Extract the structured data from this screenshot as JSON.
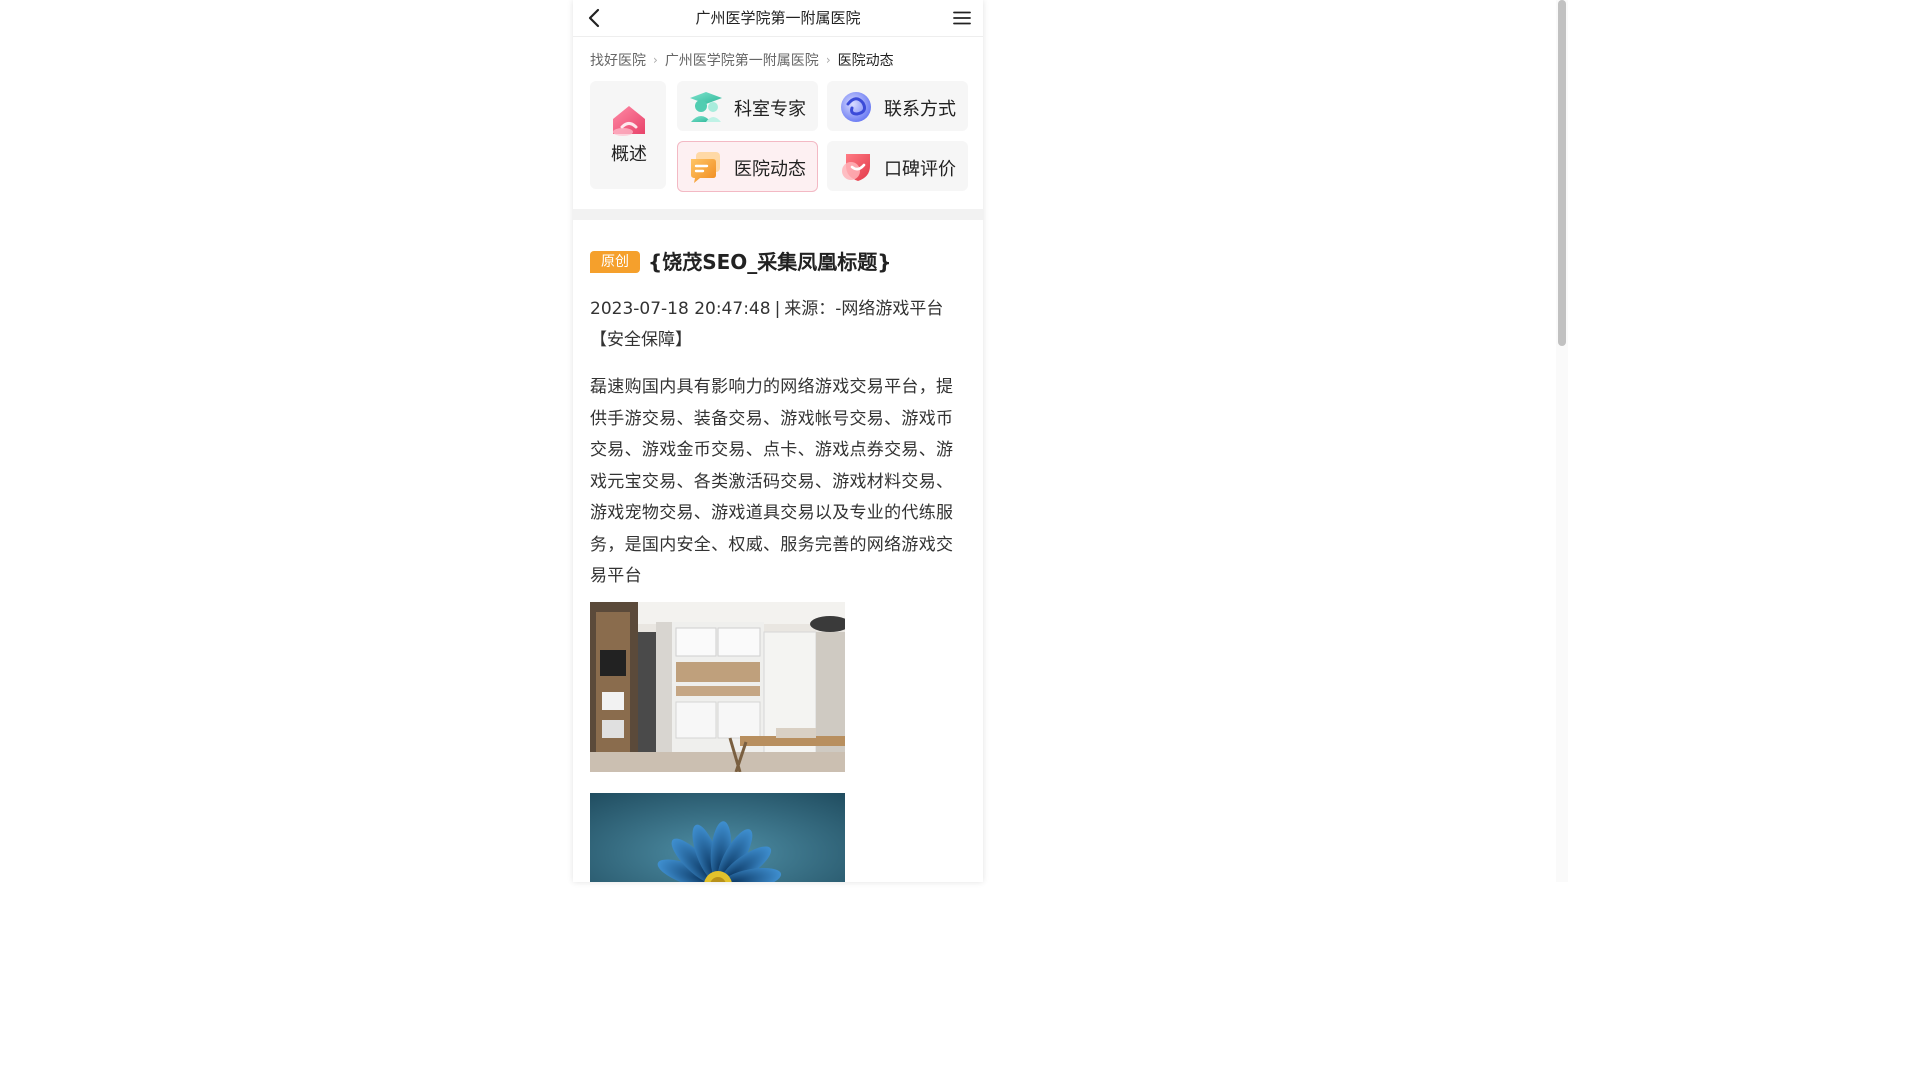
{
  "header": {
    "title": "广州医学院第一附属医院",
    "back_icon": "chevron-left-icon",
    "menu_icon": "hamburger-menu-icon"
  },
  "breadcrumb": {
    "items": [
      "找好医院",
      "广州医学院第一附属医院",
      "医院动态"
    ]
  },
  "nav": {
    "overview": {
      "label": "概述",
      "icon": "home-icon"
    },
    "tiles": [
      {
        "label": "科室专家",
        "icon": "doctor-group-icon"
      },
      {
        "label": "联系方式",
        "icon": "contact-swirl-icon"
      },
      {
        "label": "医院动态",
        "icon": "chat-bubble-icon",
        "active": true
      },
      {
        "label": "口碑评价",
        "icon": "heart-shield-icon"
      }
    ]
  },
  "article": {
    "badge": "原创",
    "title": "{饶茂SEO_采集凤凰标题}",
    "datetime": "2023-07-18 20:47:48",
    "separator": "|",
    "source": "来源：-网络游戏平台【安全保障】",
    "body": "磊速购国内具有影响力的网络游戏交易平台，提供手游交易、装备交易、游戏帐号交易、游戏币交易、游戏金币交易、点卡、游戏点券交易、游戏元宝交易、各类激活码交易、游戏材料交易、游戏宠物交易、游戏道具交易以及专业的代练服务，是国内安全、权威、服务完善的网络游戏交易平台",
    "images": [
      "kitchen-interior-photo",
      "blue-flower-photo"
    ]
  },
  "colors": {
    "badge": "#f5a02c",
    "active_tile_bg": "#fdf0f2",
    "active_tile_border": "#f3b9c4",
    "tile_bg": "#f6f6f6"
  }
}
